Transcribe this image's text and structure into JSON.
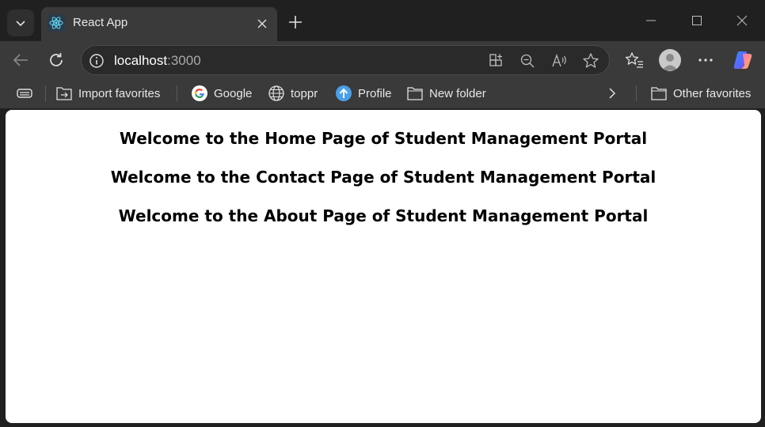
{
  "browser": {
    "tab": {
      "title": "React App",
      "favicon": "react-logo-icon"
    },
    "address_bar": {
      "host": "localhost",
      "port": ":3000"
    },
    "favorites": [
      {
        "label": "Import favorites",
        "icon": "import-favorites-icon"
      },
      {
        "label": "Google",
        "icon": "google-icon"
      },
      {
        "label": "toppr",
        "icon": "globe-icon"
      },
      {
        "label": "Profile",
        "icon": "upload-arrow-icon"
      },
      {
        "label": "New folder",
        "icon": "folder-icon"
      }
    ],
    "other_favorites": "Other favorites"
  },
  "page": {
    "headings": [
      "Welcome to the Home Page of Student Management Portal",
      "Welcome to the Contact Page of Student Management Portal",
      "Welcome to the About Page of Student Management Portal"
    ]
  },
  "colors": {
    "chrome_dark": "#202020",
    "toolbar": "#3a3a3a",
    "page_bg": "#ffffff",
    "react_cyan": "#61dafb"
  }
}
